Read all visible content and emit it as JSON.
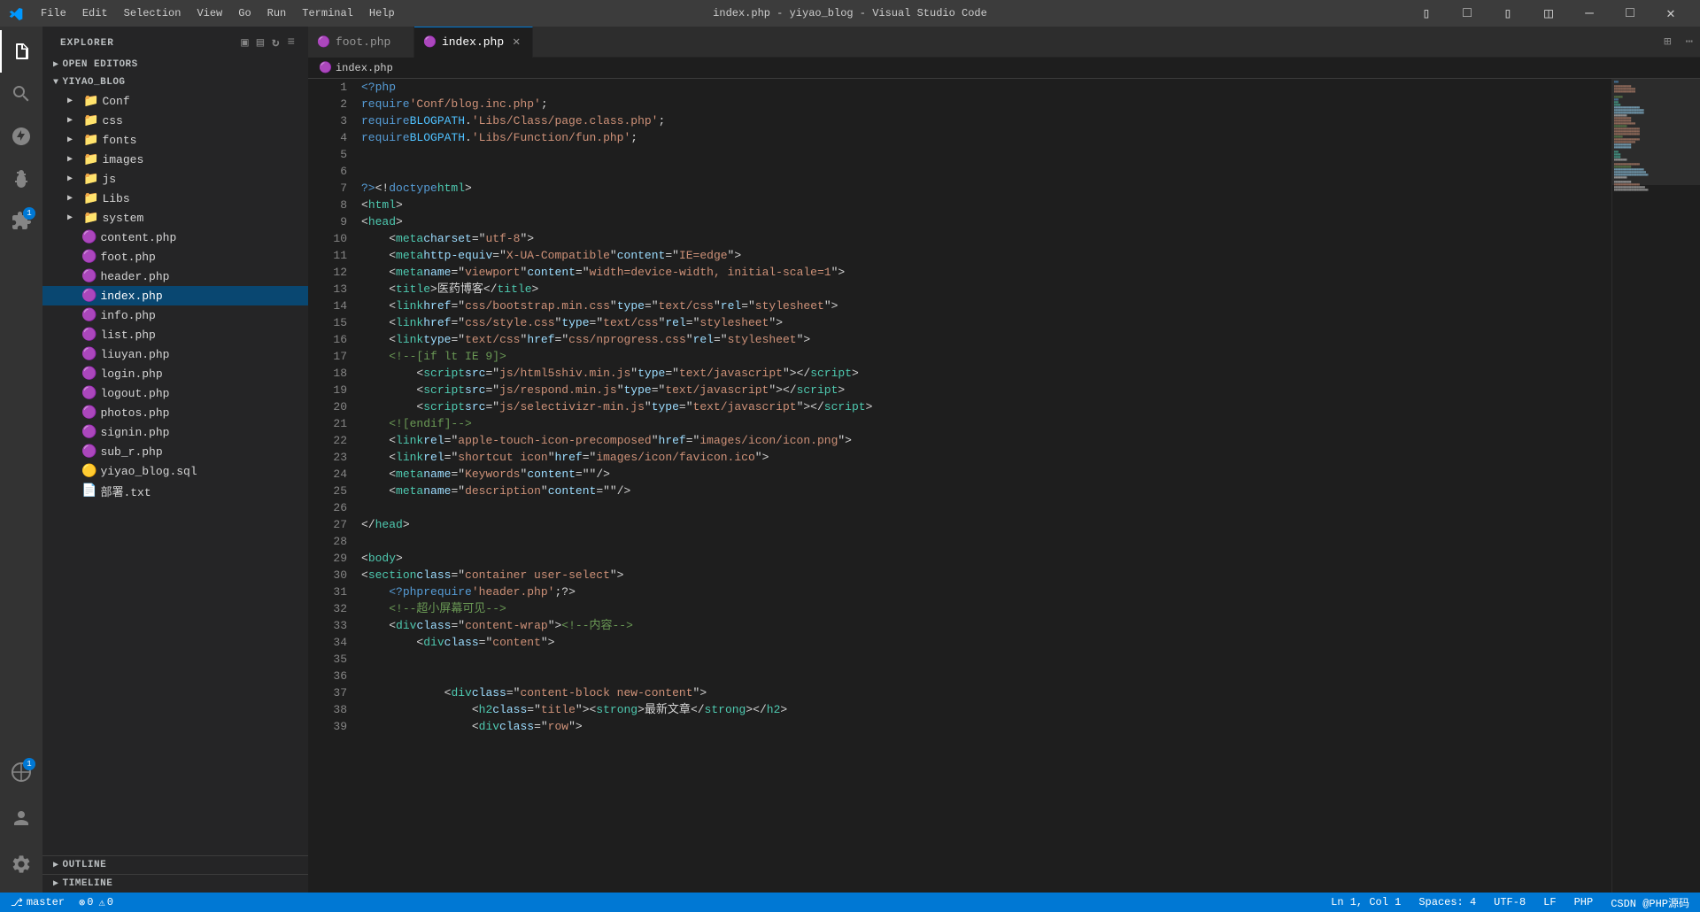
{
  "titlebar": {
    "title": "index.php - yiyao_blog - Visual Studio Code",
    "menu_items": [
      "File",
      "Edit",
      "Selection",
      "View",
      "Go",
      "Run",
      "Terminal",
      "Help"
    ],
    "controls": [
      "minimize",
      "maximize",
      "close"
    ]
  },
  "sidebar": {
    "header": "EXPLORER",
    "open_editors_label": "OPEN EDITORS",
    "project_name": "YIYAO_BLOG",
    "folders": [
      {
        "name": "Conf",
        "type": "folder",
        "expanded": false
      },
      {
        "name": "css",
        "type": "folder",
        "expanded": false
      },
      {
        "name": "fonts",
        "type": "folder",
        "expanded": false
      },
      {
        "name": "images",
        "type": "folder",
        "expanded": false
      },
      {
        "name": "js",
        "type": "folder",
        "expanded": false
      },
      {
        "name": "Libs",
        "type": "folder",
        "expanded": false
      },
      {
        "name": "system",
        "type": "folder",
        "expanded": false
      }
    ],
    "files": [
      {
        "name": "content.php",
        "type": "php",
        "active": false
      },
      {
        "name": "foot.php",
        "type": "php",
        "active": false
      },
      {
        "name": "header.php",
        "type": "php",
        "active": false
      },
      {
        "name": "index.php",
        "type": "php",
        "active": true
      },
      {
        "name": "info.php",
        "type": "php",
        "active": false
      },
      {
        "name": "list.php",
        "type": "php",
        "active": false
      },
      {
        "name": "liuyan.php",
        "type": "php",
        "active": false
      },
      {
        "name": "login.php",
        "type": "php",
        "active": false
      },
      {
        "name": "logout.php",
        "type": "php",
        "active": false
      },
      {
        "name": "photos.php",
        "type": "php",
        "active": false
      },
      {
        "name": "signin.php",
        "type": "php",
        "active": false
      },
      {
        "name": "sub_r.php",
        "type": "php",
        "active": false
      },
      {
        "name": "yiyao_blog.sql",
        "type": "sql",
        "active": false
      },
      {
        "name": "部署.txt",
        "type": "txt",
        "active": false
      }
    ],
    "outline_label": "OUTLINE",
    "timeline_label": "TIMELINE"
  },
  "tabs": [
    {
      "name": "foot.php",
      "type": "php",
      "active": false,
      "modified": false
    },
    {
      "name": "index.php",
      "type": "php",
      "active": true,
      "modified": false
    }
  ],
  "breadcrumb": {
    "file": "index.php"
  },
  "editor": {
    "lines": [
      {
        "num": 1,
        "content": "php_open"
      },
      {
        "num": 2,
        "content": "require_conf"
      },
      {
        "num": 3,
        "content": "require_page"
      },
      {
        "num": 4,
        "content": "require_fun"
      },
      {
        "num": 5,
        "content": "empty"
      },
      {
        "num": 6,
        "content": "empty"
      },
      {
        "num": 7,
        "content": "php_close_doctype"
      },
      {
        "num": 8,
        "content": "html_open"
      },
      {
        "num": 9,
        "content": "head_open"
      },
      {
        "num": 10,
        "content": "meta_charset"
      },
      {
        "num": 11,
        "content": "meta_compat"
      },
      {
        "num": 12,
        "content": "meta_viewport"
      },
      {
        "num": 13,
        "content": "title"
      },
      {
        "num": 14,
        "content": "link_bootstrap"
      },
      {
        "num": 15,
        "content": "link_style"
      },
      {
        "num": 16,
        "content": "link_nprogress"
      },
      {
        "num": 17,
        "content": "comment_ie"
      },
      {
        "num": 18,
        "content": "script_html5shiv"
      },
      {
        "num": 19,
        "content": "script_respond"
      },
      {
        "num": 20,
        "content": "script_selectivizr"
      },
      {
        "num": 21,
        "content": "comment_endif"
      },
      {
        "num": 22,
        "content": "link_apple"
      },
      {
        "num": 23,
        "content": "link_shortcut"
      },
      {
        "num": 24,
        "content": "meta_keywords"
      },
      {
        "num": 25,
        "content": "meta_description"
      },
      {
        "num": 26,
        "content": "empty"
      },
      {
        "num": 27,
        "content": "head_close"
      },
      {
        "num": 28,
        "content": "empty"
      },
      {
        "num": 29,
        "content": "body_open"
      },
      {
        "num": 30,
        "content": "section_container"
      },
      {
        "num": 31,
        "content": "require_header"
      },
      {
        "num": 32,
        "content": "comment_small"
      },
      {
        "num": 33,
        "content": "div_content_wrap"
      },
      {
        "num": 34,
        "content": "div_content"
      },
      {
        "num": 35,
        "content": "empty_indent"
      },
      {
        "num": 36,
        "content": "empty_indent"
      },
      {
        "num": 37,
        "content": "div_content_block"
      },
      {
        "num": 38,
        "content": "h2_title"
      },
      {
        "num": 39,
        "content": "div_row"
      }
    ]
  },
  "status_bar": {
    "left": [
      "git_branch",
      "sync"
    ],
    "git_branch": "⎇  master",
    "errors": "⊗ 0",
    "warnings": "⚠ 0",
    "right_items": [
      "Ln 1, Col 1",
      "Spaces: 4",
      "UTF-8",
      "LF",
      "PHP",
      "CSDN @PHP源码"
    ]
  }
}
